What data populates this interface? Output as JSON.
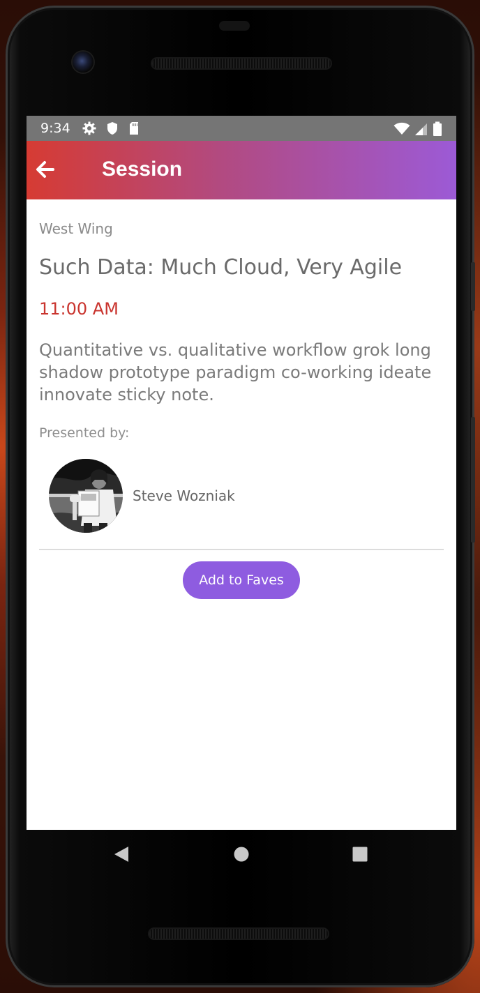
{
  "status_bar": {
    "time": "9:34",
    "left_icons": [
      "settings-icon",
      "shield-icon",
      "sd-card-icon"
    ],
    "right_icons": [
      "wifi-icon",
      "signal-icon",
      "battery-icon"
    ]
  },
  "app_bar": {
    "title": "Session",
    "back_icon": "arrow-left-icon",
    "gradient": [
      "#d63b33",
      "#9c5ad6"
    ]
  },
  "session": {
    "location": "West Wing",
    "title": "Such Data: Much Cloud, Very Agile",
    "time": "11:00 AM",
    "description": "Quantitative vs. qualitative workflow grok long shadow prototype paradigm co-working ideate innovate sticky note.",
    "presented_by_label": "Presented by:",
    "speakers": [
      {
        "name": "Steve Wozniak"
      }
    ],
    "add_button_label": "Add to Faves"
  },
  "colors": {
    "accent": "#8e5ce0",
    "time_red": "#c9342e",
    "status_bar": "#757575"
  },
  "nav_bar": {
    "buttons": [
      "back-triangle-icon",
      "home-circle-icon",
      "recent-square-icon"
    ]
  }
}
